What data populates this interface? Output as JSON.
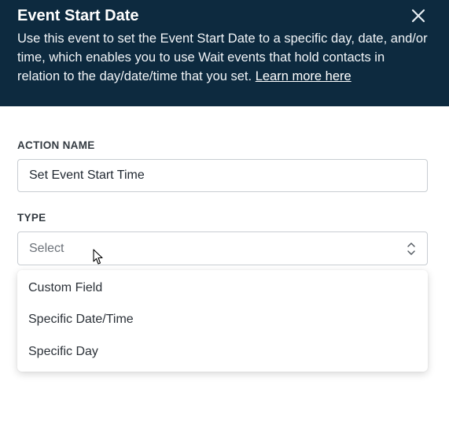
{
  "header": {
    "title": "Event Start Date",
    "description": "Use this event to set the Event Start Date to a specific day, date, and/or time, which enables you to use Wait events that hold contacts in relation to the day/date/time that you set.",
    "learn_more": "Learn more here",
    "close_icon": "close-icon",
    "background": "#0d2a3f"
  },
  "action_name": {
    "label": "ACTION NAME",
    "value": "Set Event Start Time"
  },
  "type": {
    "label": "TYPE",
    "placeholder": "Select",
    "icon": "chevron-up-down-icon",
    "options": [
      "Custom Field",
      "Specific Date/Time",
      "Specific Day"
    ]
  }
}
